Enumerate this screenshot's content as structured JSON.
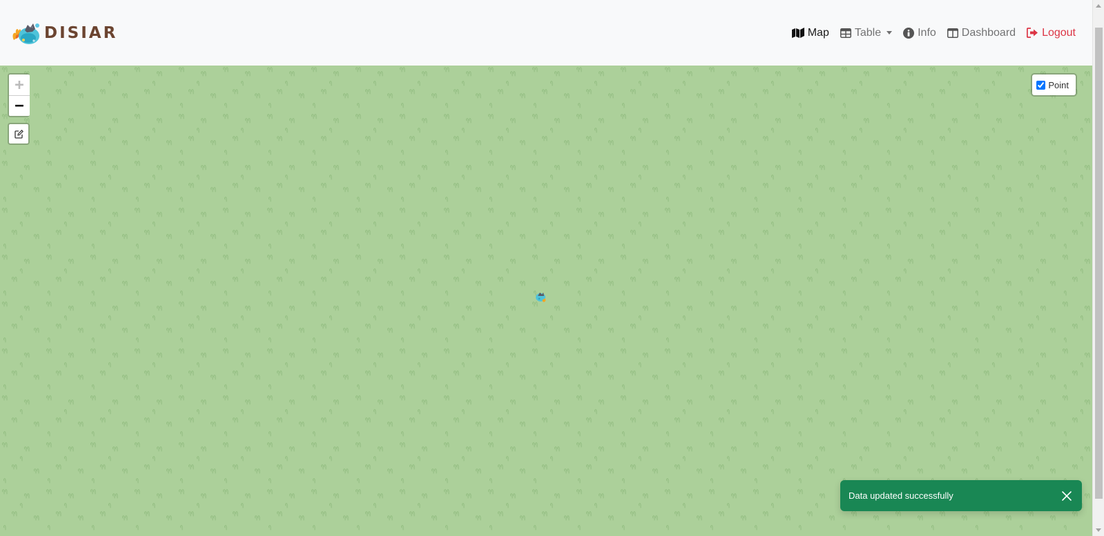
{
  "brand": {
    "name": "DISIAR",
    "logo_icon": "disiar-logo-icon"
  },
  "nav": {
    "items": [
      {
        "label": "Map",
        "icon": "map-icon",
        "active": true
      },
      {
        "label": "Table",
        "icon": "table-icon",
        "dropdown": true
      },
      {
        "label": "Info",
        "icon": "info-circle-icon"
      },
      {
        "label": "Dashboard",
        "icon": "columns-icon"
      },
      {
        "label": "Logout",
        "icon": "sign-out-icon",
        "color": "#dc3545"
      }
    ]
  },
  "map": {
    "background_color": "#acd09a",
    "zoom_in_label": "+",
    "zoom_out_label": "−",
    "zoom_in_disabled": true,
    "draw_tool_icon": "edit-icon",
    "layers": [
      {
        "label": "Point",
        "checked": true
      }
    ],
    "marker_icon": "disiar-marker-icon"
  },
  "toast": {
    "message": "Data updated successfully",
    "color": "#198754",
    "close_icon": "close-icon"
  }
}
